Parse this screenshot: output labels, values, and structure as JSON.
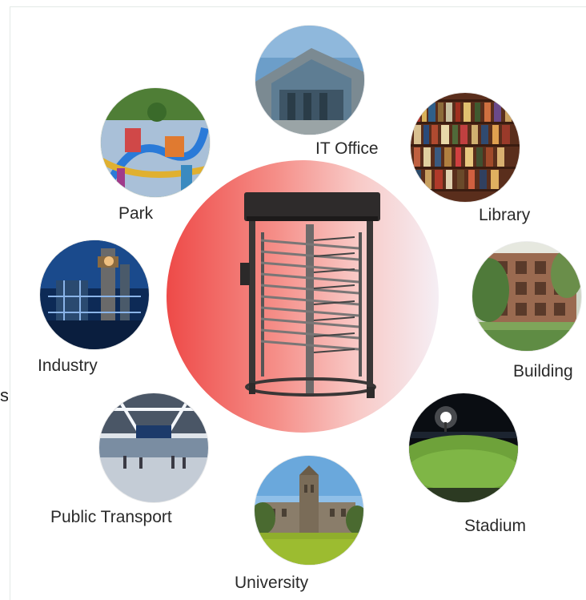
{
  "edge_text": "s",
  "center": {
    "icon": "turnstile-icon"
  },
  "applications": [
    {
      "key": "it-office",
      "label": "IT Office",
      "icon": "office-building-photo"
    },
    {
      "key": "library",
      "label": "Library",
      "icon": "bookshelf-photo"
    },
    {
      "key": "building",
      "label": "Building",
      "icon": "apartment-photo"
    },
    {
      "key": "stadium",
      "label": "Stadium",
      "icon": "stadium-night-photo"
    },
    {
      "key": "university",
      "label": "University",
      "icon": "university-campus-photo"
    },
    {
      "key": "public-transport",
      "label": "Public Transport",
      "icon": "transit-station-photo"
    },
    {
      "key": "industry",
      "label": "Industry",
      "icon": "industrial-plant-photo"
    },
    {
      "key": "park",
      "label": "Park",
      "icon": "amusement-park-photo"
    }
  ],
  "colors": {
    "disc_left": "#ee4a48",
    "disc_right": "#f5eef4",
    "label_text": "#2a2a2a"
  }
}
